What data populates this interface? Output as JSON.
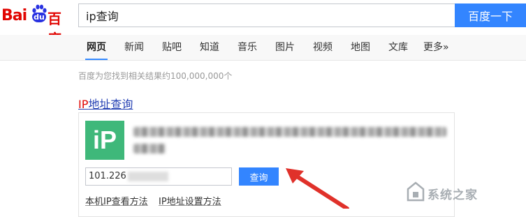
{
  "header": {
    "logo_bai": "Bai",
    "logo_du": "du",
    "logo_cn": "百度",
    "search_value": "ip查询",
    "search_button": "百度一下"
  },
  "nav": {
    "tabs": [
      {
        "label": "网页",
        "active": true
      },
      {
        "label": "新闻"
      },
      {
        "label": "贴吧"
      },
      {
        "label": "知道"
      },
      {
        "label": "音乐"
      },
      {
        "label": "图片"
      },
      {
        "label": "视频"
      },
      {
        "label": "地图"
      },
      {
        "label": "文库"
      },
      {
        "label": "更多»"
      }
    ]
  },
  "results": {
    "count_text": "百度为您找到相关结果约100,000,000个",
    "ip_title_prefix": "IP",
    "ip_title_rest": "地址查询",
    "card": {
      "logo_text": "iP",
      "ip_input_value": "101.226",
      "query_button": "查询",
      "link_1": "本机IP查看方法",
      "link_2": "IP地址设置方法"
    }
  },
  "watermark": {
    "text": "系统之家"
  },
  "colors": {
    "brand_red": "#e10602",
    "brand_blue": "#3385ff",
    "ip_logo_green": "#3fb87a",
    "link_blue": "#2440b3",
    "arrow_red": "#e0312a"
  }
}
